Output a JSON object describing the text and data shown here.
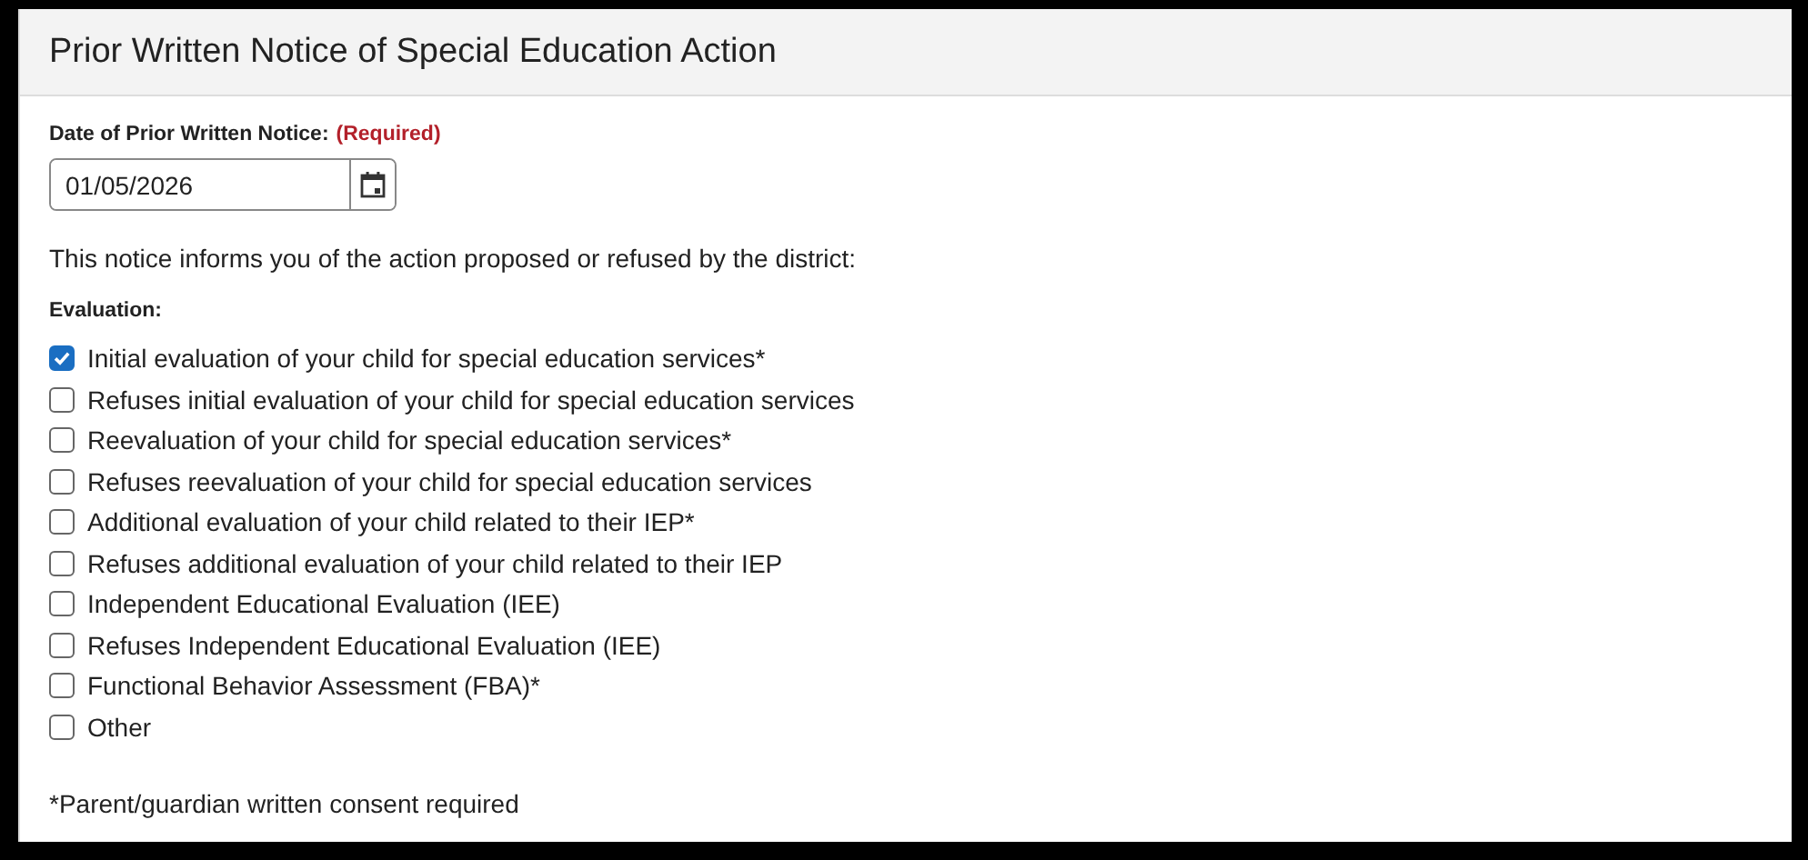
{
  "panel": {
    "title": "Prior Written Notice of Special Education Action"
  },
  "date_field": {
    "label": "Date of Prior Written Notice:",
    "required": "(Required)",
    "value": "01/05/2026"
  },
  "intro": "This notice informs you of the action proposed or refused by the district:",
  "evaluation": {
    "label": "Evaluation:",
    "options": [
      {
        "label": "Initial evaluation of your child for special education services*",
        "checked": true
      },
      {
        "label": "Refuses initial evaluation of your child for special education services",
        "checked": false
      },
      {
        "label": "Reevaluation of your child for special education services*",
        "checked": false
      },
      {
        "label": "Refuses reevaluation of your child for special education services",
        "checked": false
      },
      {
        "label": "Additional evaluation of your child related to their IEP*",
        "checked": false
      },
      {
        "label": "Refuses additional evaluation of your child related to their IEP",
        "checked": false
      },
      {
        "label": "Independent Educational Evaluation (IEE)",
        "checked": false
      },
      {
        "label": "Refuses Independent Educational Evaluation (IEE)",
        "checked": false
      },
      {
        "label": "Functional Behavior Assessment (FBA)*",
        "checked": false
      },
      {
        "label": "Other",
        "checked": false
      }
    ]
  },
  "footnote": "*Parent/guardian written consent required"
}
